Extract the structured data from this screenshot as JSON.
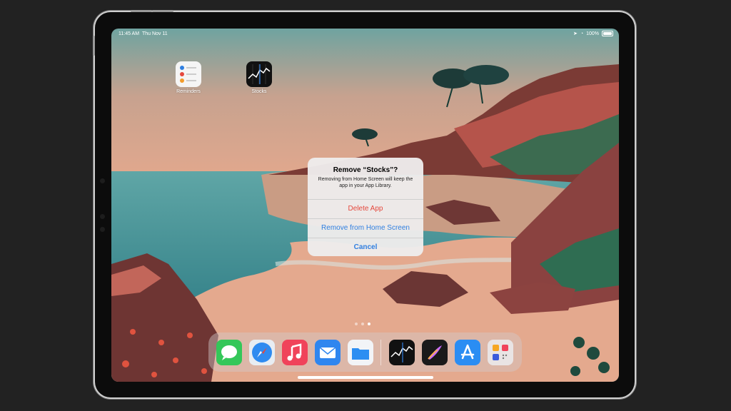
{
  "status_bar": {
    "time": "11:45 AM",
    "date": "Thu Nov 11",
    "battery": "100%"
  },
  "home": {
    "apps": [
      {
        "label": "Reminders",
        "icon": "reminders-icon"
      },
      {
        "label": "Stocks",
        "icon": "stocks-icon"
      }
    ],
    "page_dots": 3,
    "active_page": 3
  },
  "alert": {
    "title": "Remove “Stocks”?",
    "message": "Removing from Home Screen will keep the app in your App Library.",
    "actions": [
      {
        "label": "Delete App",
        "color": "#e5483d"
      },
      {
        "label": "Remove from Home Screen",
        "color": "#2f7fe0"
      },
      {
        "label": "Cancel",
        "color": "#2f7fe0"
      }
    ]
  },
  "dock": {
    "apps": [
      "messages-icon",
      "safari-icon",
      "music-icon",
      "mail-icon",
      "files-icon",
      "stocks-icon",
      "procreate-icon",
      "app-store-icon",
      "app-library-icon"
    ]
  },
  "colors": {
    "accent_blue": "#2f7fe0",
    "destructive_red": "#e5483d"
  }
}
